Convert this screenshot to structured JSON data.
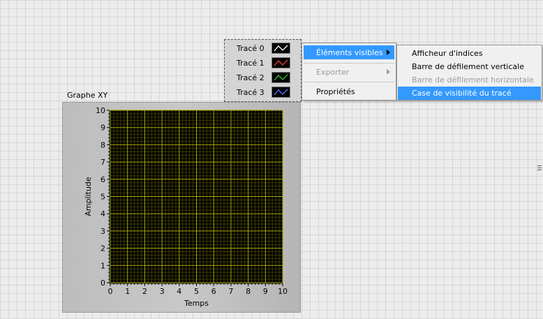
{
  "graph": {
    "title": "Graphe XY",
    "xlabel": "Temps",
    "ylabel": "Amplitude"
  },
  "chart_data": {
    "type": "line",
    "title": "Graphe XY",
    "xlabel": "Temps",
    "ylabel": "Amplitude",
    "xlim": [
      0,
      10
    ],
    "ylim": [
      0,
      10
    ],
    "x_ticks": [
      "0",
      "1",
      "2",
      "3",
      "4",
      "5",
      "6",
      "7",
      "8",
      "9",
      "10"
    ],
    "y_ticks": [
      "0",
      "1",
      "2",
      "3",
      "4",
      "5",
      "6",
      "7",
      "8",
      "9",
      "10"
    ],
    "grid": true,
    "series": [],
    "colors": {
      "plot_bg": "#000000",
      "grid_major": "#a8a800",
      "grid_minor": "#3c3c00"
    }
  },
  "legend": {
    "items": [
      {
        "label": "Tracé 0",
        "color": "#ffffff"
      },
      {
        "label": "Tracé 1",
        "color": "#ff3b3b"
      },
      {
        "label": "Tracé 2",
        "color": "#2ecc2e"
      },
      {
        "label": "Tracé 3",
        "color": "#5a7cff"
      }
    ]
  },
  "menu": {
    "items": [
      {
        "label": "Éléments visibles",
        "has_submenu": true,
        "selected": true,
        "disabled": false
      },
      {
        "label": "Exporter",
        "has_submenu": true,
        "selected": false,
        "disabled": true
      },
      {
        "label": "Propriétés",
        "has_submenu": false,
        "selected": false,
        "disabled": false
      }
    ]
  },
  "submenu": {
    "items": [
      {
        "label": "Afficheur d'indices",
        "selected": false,
        "disabled": false
      },
      {
        "label": "Barre de défilement verticale",
        "selected": false,
        "disabled": false
      },
      {
        "label": "Barre de défilement horizontale",
        "selected": false,
        "disabled": true
      },
      {
        "label": "Case de visibilité du tracé",
        "selected": true,
        "disabled": false
      }
    ]
  }
}
